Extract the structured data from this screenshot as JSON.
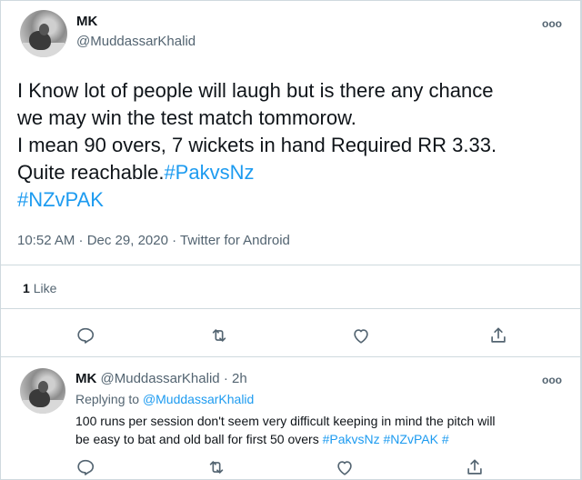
{
  "tweet": {
    "display_name": "MK",
    "handle": "@MuddassarKhalid",
    "text_lines": [
      "I Know lot of people will laugh but is there any chance",
      "we may win the test match tommorow.",
      "I mean 90 overs, 7 wickets in hand Required RR 3.33."
    ],
    "text_line4_plain": "Quite reachable.",
    "text_line4_hashtag": "#PakvsNz",
    "text_line5_hashtag": "#NZvPAK",
    "timestamp": "10:52 AM · Dec 29, 2020 · Twitter for Android",
    "like_count": "1",
    "like_label": "Like"
  },
  "reply": {
    "display_name": "MK",
    "handle": "@MuddassarKhalid",
    "time": "· 2h",
    "replying_prefix": "Replying to",
    "replying_to": "@MuddassarKhalid",
    "text_line1": "100 runs per session don't seem very difficult keeping in mind the pitch will",
    "text_line2_plain": "be easy to bat and old ball for first 50 overs",
    "text_line2_hashtags": "#PakvsNz #NZvPAK",
    "text_line2_tail": "#"
  },
  "icons": {
    "more": "more-horizontal-icon",
    "reply": "reply-icon",
    "retweet": "retweet-icon",
    "like": "heart-icon",
    "share": "share-icon"
  },
  "more_glyph": "ooo",
  "colors": {
    "link": "#1d9bf0",
    "muted": "#536471",
    "text": "#0f1419",
    "border": "#cfd9de"
  }
}
